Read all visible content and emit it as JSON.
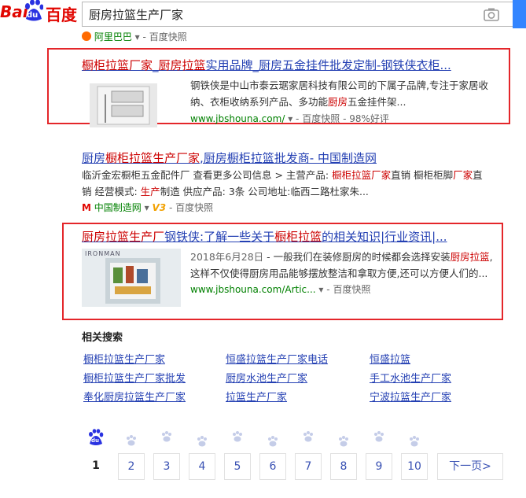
{
  "header": {
    "logo_text_latin_1": "Bai",
    "logo_text_latin_2": "du",
    "logo_text_cn": "百度",
    "search_query": "厨房拉篮生产厂家"
  },
  "top_partial": {
    "source": "阿里巴巴",
    "snapshot": "百度快照"
  },
  "results": [
    {
      "title_parts": [
        {
          "t": "橱柜拉篮厂家",
          "em": true
        },
        {
          "t": "_",
          "em": false
        },
        {
          "t": "厨房拉篮",
          "em": true
        },
        {
          "t": "实用品牌_厨房五金挂件批发定制-钢铁侠衣柜...",
          "em": false
        }
      ],
      "desc_line1": "钢铁侠是中山市泰云琚家居科技有限公司的下属子品牌,专注于家居收",
      "desc_line2_a": "纳、衣柜收纳系列产品、多功能",
      "desc_line2_em": "厨房",
      "desc_line2_b": "五金挂件架...",
      "url": "www.jbshouna.com/",
      "snapshot": "百度快照",
      "rating": "98%好评"
    },
    {
      "title_parts": [
        {
          "t": "厨房",
          "em": false
        },
        {
          "t": "橱柜拉篮生产厂家",
          "em": true
        },
        {
          "t": ",厨房橱柜拉篮批发商- 中国制造网",
          "em": false
        }
      ],
      "desc_line1_a": "临沂金宏橱柜五金配件厂 查看更多公司信息 > 主营产品: ",
      "desc_line1_em1": "橱柜拉篮厂家",
      "desc_line1_b": "直销 橱柜柜脚",
      "desc_line1_em2": "厂家",
      "desc_line1_c": "直",
      "desc_line2_a": "销 经营模式: ",
      "desc_line2_em": "生产",
      "desc_line2_b": "制造 供应产品: 3条 公司地址:临西二路杜家朱...",
      "source": "中国制造网",
      "v_badge": "V3",
      "snapshot": "百度快照"
    },
    {
      "title_parts": [
        {
          "t": "厨房拉篮生产厂",
          "em": true
        },
        {
          "t": "钢铁侠:了解一些关于",
          "em": false
        },
        {
          "t": "橱柜拉篮",
          "em": true
        },
        {
          "t": "的相关知识|行业资讯|...",
          "em": false
        }
      ],
      "thumb_brand": "IRONMAN",
      "date": "2018年6月28日",
      "desc_line1_a": " - 一般我们在装修厨房的时候都会选择安装",
      "desc_line1_em": "厨房拉篮",
      "desc_line1_b": ",",
      "desc_line2": "这样不仅使得厨房用品能够摆放整洁和拿取方便,还可以方便人们的...",
      "url": "www.jbshouna.com/Artic...",
      "snapshot": "百度快照"
    }
  ],
  "related": {
    "title": "相关搜索",
    "items": [
      "橱柜拉篮生产厂家",
      "恒盛拉篮生产厂家电话",
      "恒盛拉篮",
      "橱柜拉篮生产厂家批发",
      "厨房水池生产厂家",
      "手工水池生产厂家",
      "奉化厨房拉篮生产厂家",
      "拉篮生产厂家",
      "宁波拉篮生产厂家"
    ]
  },
  "pagination": {
    "paw_label": "du",
    "pages": [
      "1",
      "2",
      "3",
      "4",
      "5",
      "6",
      "7",
      "8",
      "9",
      "10"
    ],
    "next": "下一页>"
  },
  "colors": {
    "brand_red": "#e10601",
    "brand_blue": "#2932e1",
    "link": "#2440b3",
    "highlight": "#cc0000",
    "url_green": "#008000",
    "annotation_red": "#e4262a"
  }
}
